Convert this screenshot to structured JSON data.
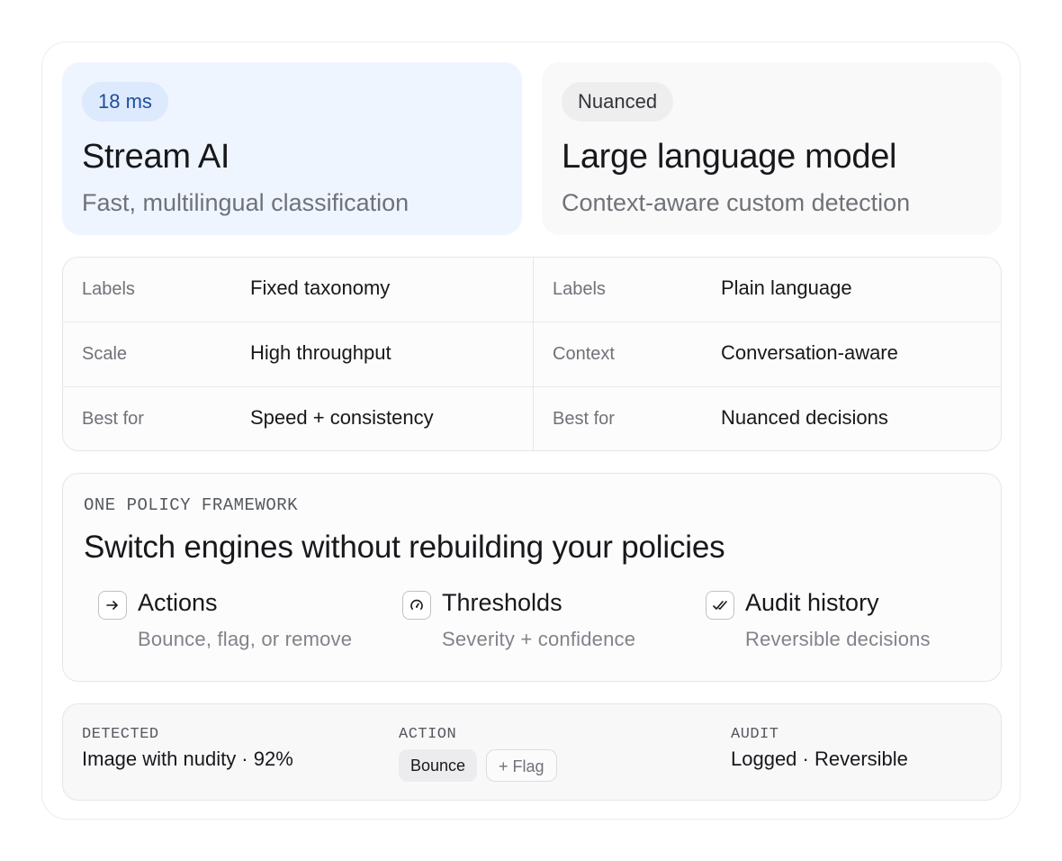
{
  "engines": {
    "stream": {
      "badge": "18 ms",
      "title": "Stream AI",
      "subtitle": "Fast, multilingual classification"
    },
    "llm": {
      "badge": "Nuanced",
      "title": "Large language model",
      "subtitle": "Context-aware custom detection"
    }
  },
  "comparison": {
    "stream_rows": [
      {
        "key": "Labels",
        "value": "Fixed taxonomy"
      },
      {
        "key": "Scale",
        "value": "High throughput"
      },
      {
        "key": "Best for",
        "value": "Speed + consistency"
      }
    ],
    "llm_rows": [
      {
        "key": "Labels",
        "value": "Plain language"
      },
      {
        "key": "Context",
        "value": "Conversation-aware"
      },
      {
        "key": "Best for",
        "value": "Nuanced decisions"
      }
    ]
  },
  "policy": {
    "eyebrow": "ONE POLICY FRAMEWORK",
    "heading": "Switch engines without rebuilding your policies",
    "features": [
      {
        "title": "Actions",
        "desc": "Bounce, flag, or remove",
        "icon": "arrow-right-icon"
      },
      {
        "title": "Thresholds",
        "desc": "Severity + confidence",
        "icon": "gauge-icon"
      },
      {
        "title": "Audit history",
        "desc": "Reversible decisions",
        "icon": "double-check-icon"
      }
    ]
  },
  "status": {
    "detected_label": "DETECTED",
    "detected_value": "Image with nudity · 92%",
    "action_label": "ACTION",
    "action_primary": "Bounce",
    "action_secondary": "+ Flag",
    "audit_label": "AUDIT",
    "audit_value": "Logged · Reversible"
  },
  "colors": {
    "stream_card_bg": "#eff5ff",
    "stream_badge_bg": "#dde9fc",
    "stream_badge_text": "#1e4f9a",
    "llm_card_bg": "#f9f9fa"
  }
}
